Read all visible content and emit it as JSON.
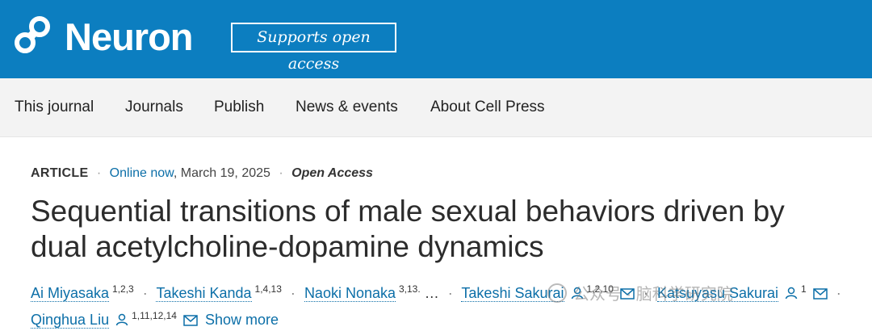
{
  "header": {
    "brand": "Neuron",
    "badge": "Supports open access"
  },
  "nav": [
    "This journal",
    "Journals",
    "Publish",
    "News & events",
    "About Cell Press"
  ],
  "meta": {
    "type": "ARTICLE",
    "online": "Online now",
    "date": "March 19, 2025",
    "access": "Open Access"
  },
  "title_line1": "Sequential transitions of male sexual behaviors driven by",
  "title_line2": "dual acetylcholine-dopamine dynamics",
  "authors": {
    "a1": {
      "name": "Ai Miyasaka",
      "aff": "1,2,3"
    },
    "a2": {
      "name": "Takeshi Kanda",
      "aff": "1,4,13"
    },
    "a3": {
      "name": "Naoki Nonaka",
      "aff": "3,13."
    },
    "ellipsis": "…",
    "a4": {
      "name": "Takeshi Sakurai",
      "aff": "1,2,10"
    },
    "a5": {
      "name": "Katsuyasu Sakurai",
      "aff": "1"
    },
    "a6": {
      "name": "Qinghua Liu",
      "aff": "1,11,12,14"
    },
    "show_more": "Show more"
  },
  "watermark": "公众号 · 脑科学研究院",
  "colors": {
    "header_bg": "#0c7ec0",
    "link": "#0c6fa8",
    "nav_bg": "#f3f3f3"
  }
}
